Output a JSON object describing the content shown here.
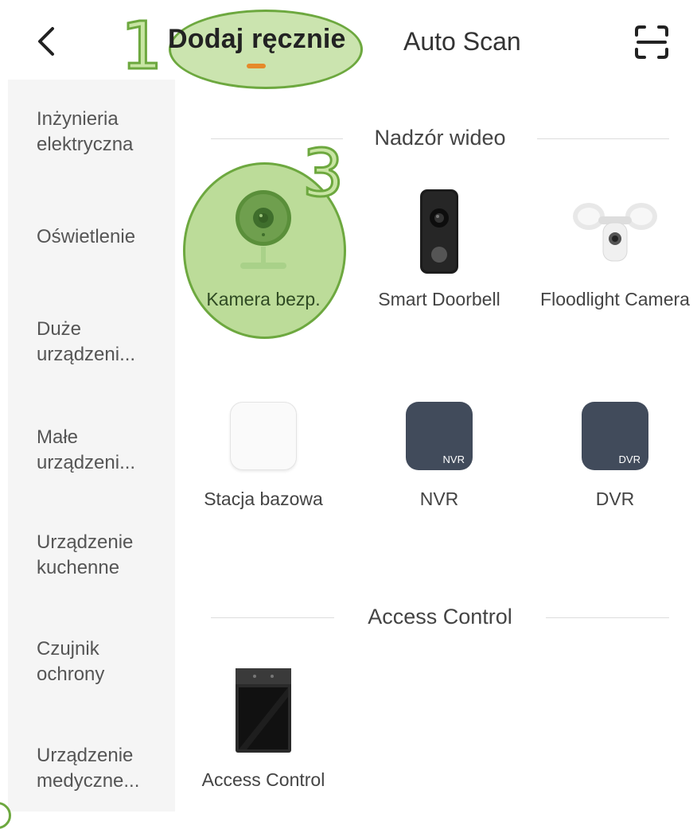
{
  "header": {
    "tab_manual": "Dodaj ręcznie",
    "tab_auto": "Auto Scan",
    "icons": [
      "back-arrow-icon",
      "scan-icon"
    ],
    "accent_color": "#e58a2a"
  },
  "annotations": {
    "step1": "1",
    "step3": "3"
  },
  "sidebar": {
    "items": [
      {
        "label": "Inżynieria elektryczna"
      },
      {
        "label": "Oświetlenie"
      },
      {
        "label": "Duże urządzeni..."
      },
      {
        "label": "Małe urządzeni..."
      },
      {
        "label": "Urządzenie kuchenne"
      },
      {
        "label": "Czujnik ochrony"
      },
      {
        "label": "Urządzenie medyczne..."
      }
    ]
  },
  "sections": [
    {
      "title": "Nadzór wideo",
      "items": [
        {
          "label": "Kamera bezp.",
          "icon": "security-camera-icon"
        },
        {
          "label": "Smart Doorbell",
          "icon": "doorbell-icon"
        },
        {
          "label": "Floodlight Camera",
          "icon": "floodlight-camera-icon"
        },
        {
          "label": "Stacja bazowa",
          "icon": "base-station-icon"
        },
        {
          "label": "NVR",
          "icon": "nvr-icon",
          "badge": "NVR"
        },
        {
          "label": "DVR",
          "icon": "dvr-icon",
          "badge": "DVR"
        }
      ]
    },
    {
      "title": "Access Control",
      "items": [
        {
          "label": "Access Control",
          "icon": "access-control-panel-icon"
        }
      ]
    }
  ]
}
